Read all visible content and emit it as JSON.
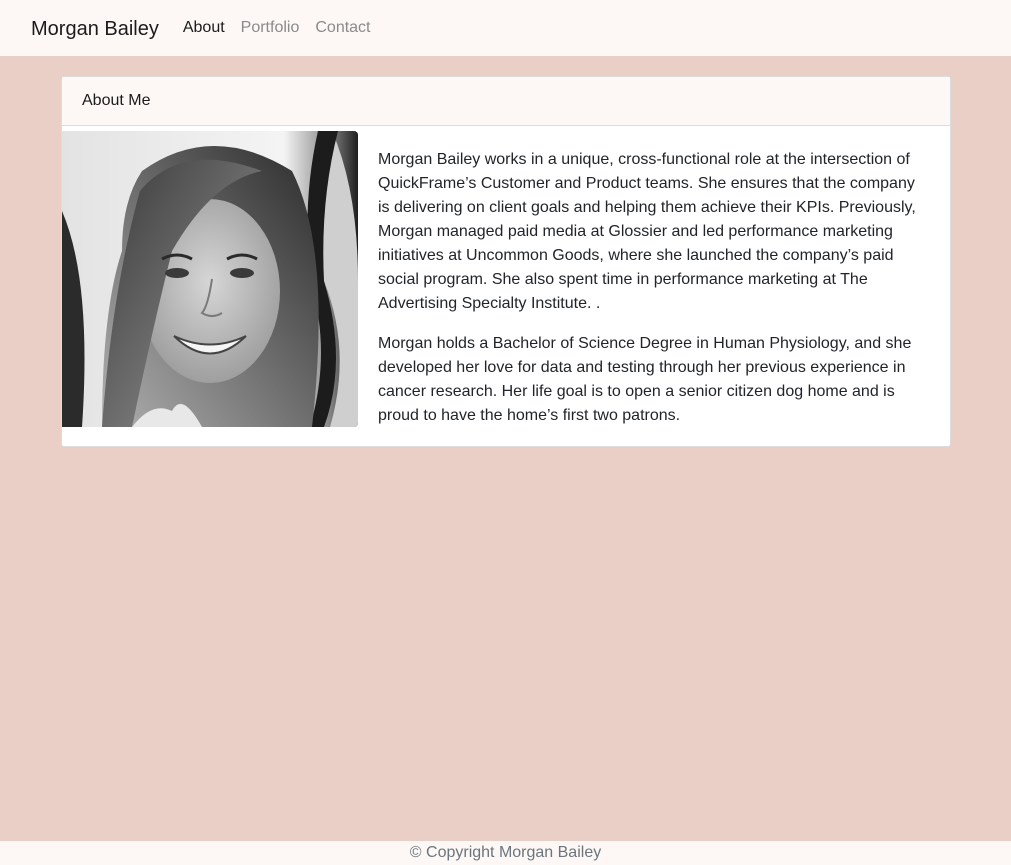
{
  "navbar": {
    "brand": "Morgan Bailey",
    "links": [
      {
        "label": "About",
        "active": true
      },
      {
        "label": "Portfolio",
        "active": false
      },
      {
        "label": "Contact",
        "active": false
      }
    ]
  },
  "card": {
    "header": "About Me",
    "photo_icon": "portrait-photo",
    "paragraphs": [
      "Morgan Bailey works in a unique, cross-functional role at the intersection of QuickFrame’s Customer and Product teams. She ensures that the company is delivering on client goals and helping them achieve their KPIs. Previously, Morgan managed paid media at Glossier and led performance marketing initiatives at Uncommon Goods, where she launched the company’s paid social program. She also spent time in performance marketing at The Advertising Specialty Institute. .",
      "Morgan holds a Bachelor of Science Degree in Human Physiology, and she developed her love for data and testing through her previous experience in cancer research. Her life goal is to open a senior citizen dog home and is proud to have the home’s first two patrons."
    ]
  },
  "footer": {
    "copyright": "© Copyright Morgan Bailey"
  },
  "colors": {
    "page_background": "#eacfc6",
    "navbar_background": "#fdf8f6",
    "card_background": "#ffffff",
    "muted_text": "#6c757d"
  }
}
